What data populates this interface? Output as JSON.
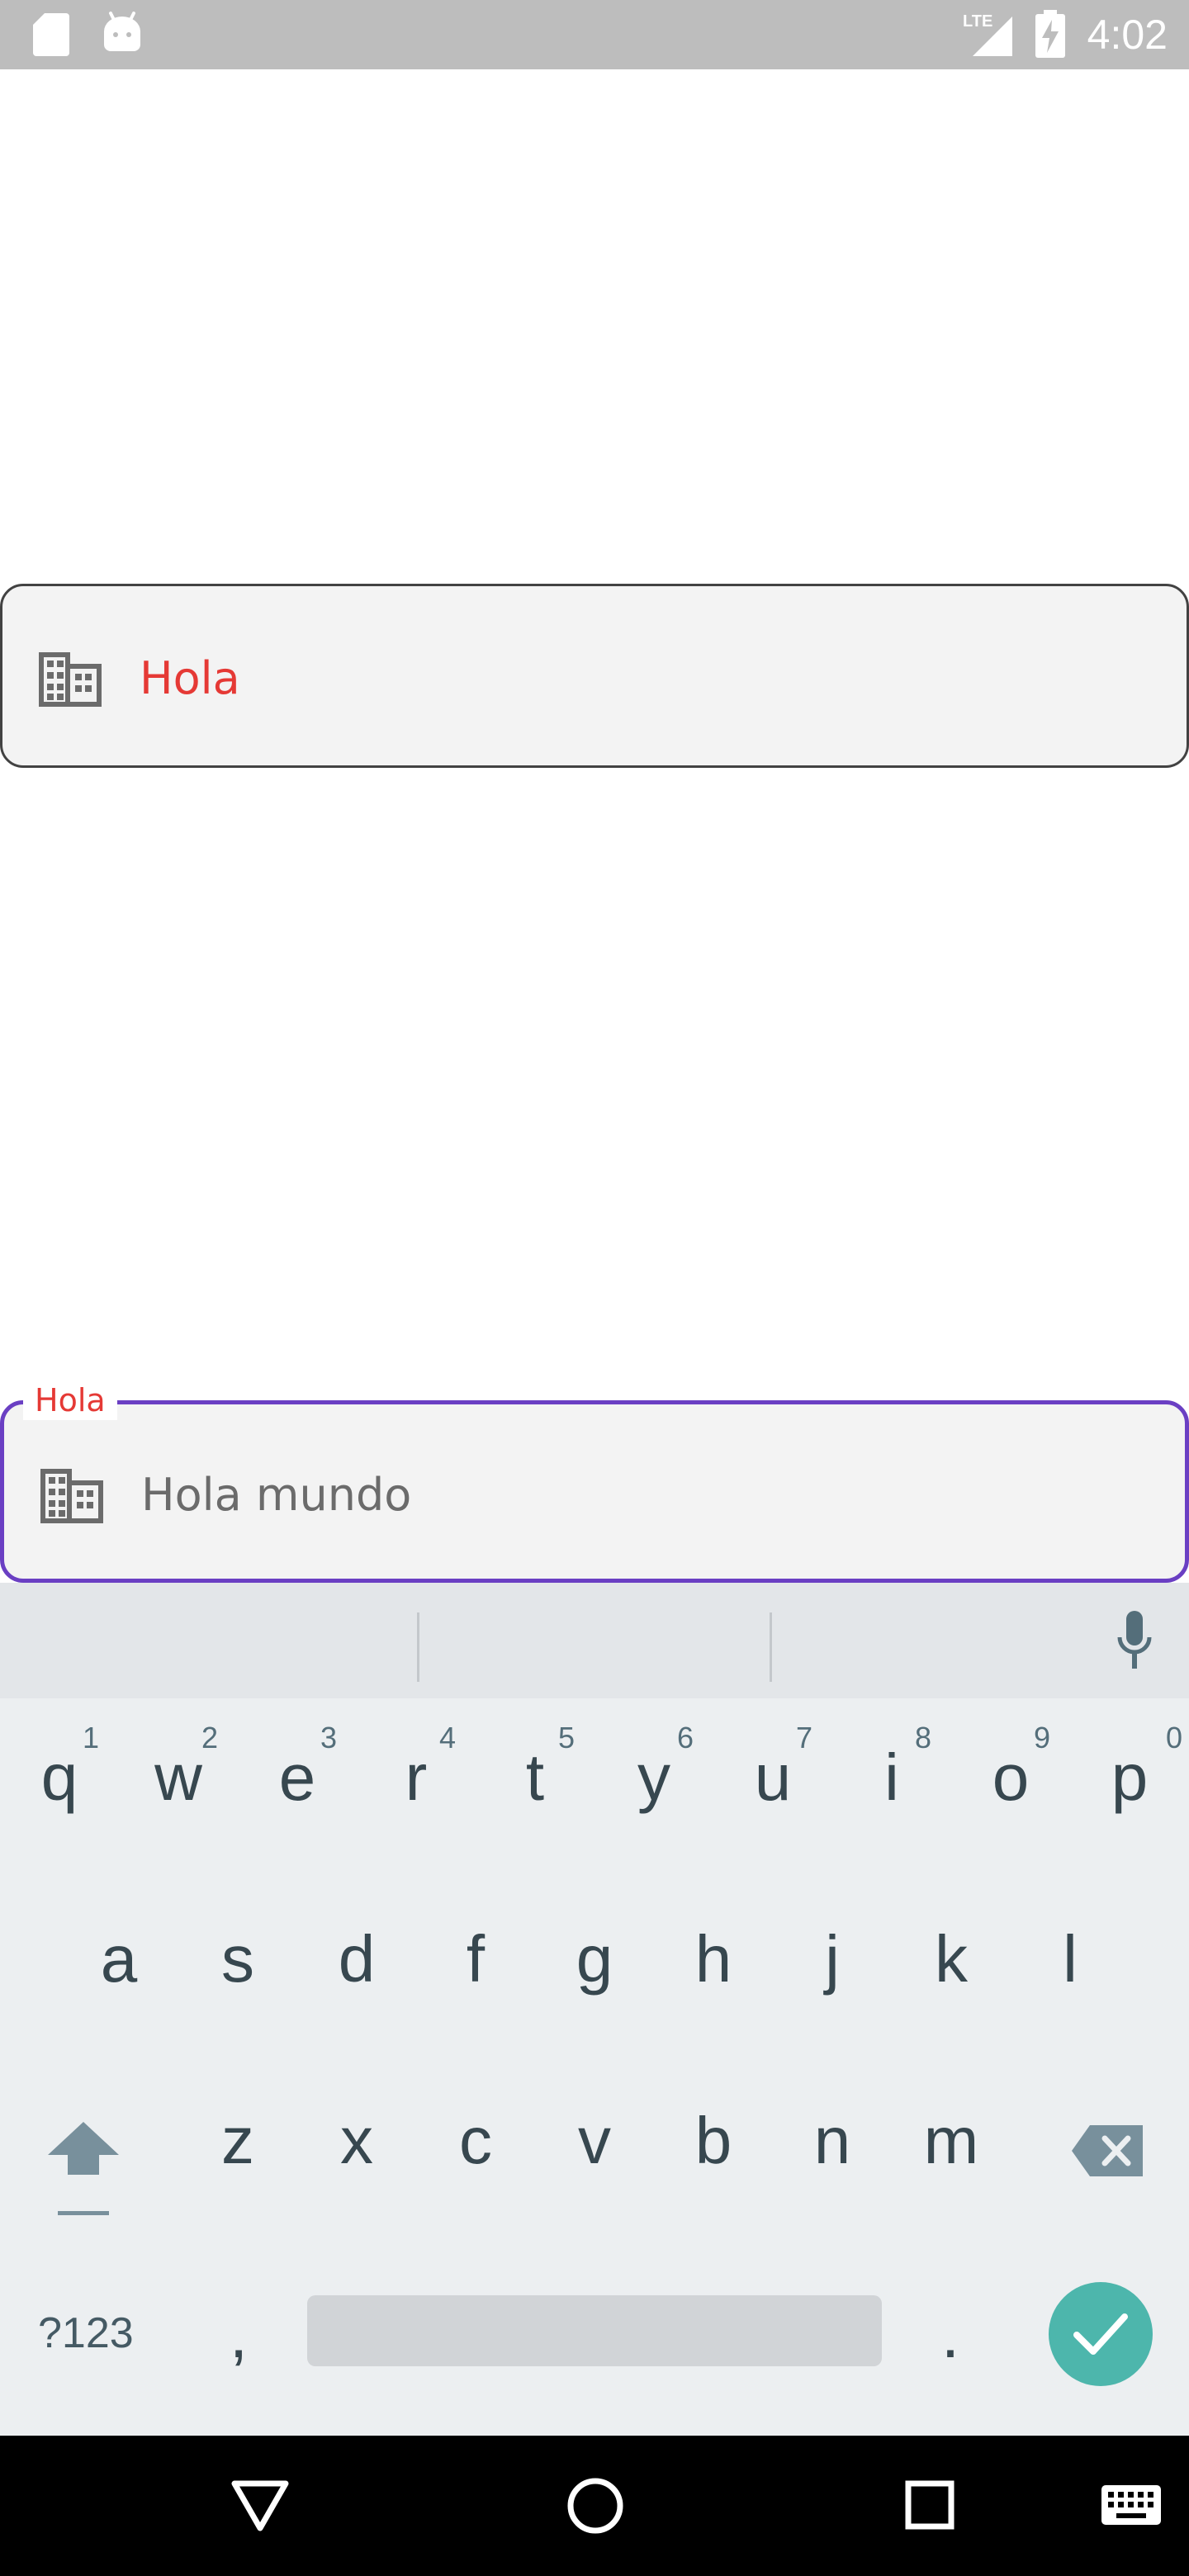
{
  "status_bar": {
    "time": "4:02",
    "network": "LTE",
    "icons": [
      "sd-card-icon",
      "android-debug-icon",
      "lte-signal-icon",
      "battery-charging-icon"
    ]
  },
  "field_top": {
    "icon": "business-icon",
    "value": "Hola",
    "value_color": "#e53935"
  },
  "field_bottom": {
    "icon": "business-icon",
    "label": "Hola",
    "value": "Hola mundo",
    "border_color": "#6a3fc3",
    "label_color": "#e53935"
  },
  "keyboard": {
    "row1": [
      {
        "key": "q",
        "hint": "1"
      },
      {
        "key": "w",
        "hint": "2"
      },
      {
        "key": "e",
        "hint": "3"
      },
      {
        "key": "r",
        "hint": "4"
      },
      {
        "key": "t",
        "hint": "5"
      },
      {
        "key": "y",
        "hint": "6"
      },
      {
        "key": "u",
        "hint": "7"
      },
      {
        "key": "i",
        "hint": "8"
      },
      {
        "key": "o",
        "hint": "9"
      },
      {
        "key": "p",
        "hint": "0"
      }
    ],
    "row2": [
      "a",
      "s",
      "d",
      "f",
      "g",
      "h",
      "j",
      "k",
      "l"
    ],
    "row3": [
      "z",
      "x",
      "c",
      "v",
      "b",
      "n",
      "m"
    ],
    "symbols_label": "?123",
    "comma": ",",
    "period": ".",
    "icons": [
      "shift-icon",
      "backspace-icon",
      "mic-icon",
      "check-icon"
    ],
    "enter_color": "#4db6ac"
  },
  "nav_bar": {
    "icons": [
      "back-icon",
      "home-icon",
      "recents-icon",
      "keyboard-icon"
    ]
  }
}
